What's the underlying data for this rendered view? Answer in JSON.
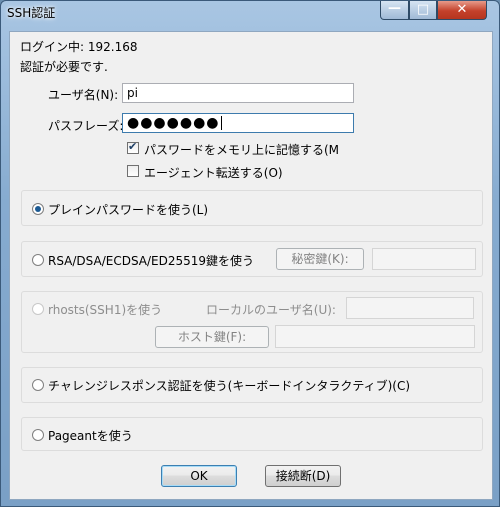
{
  "window": {
    "title": "SSH認証",
    "controls": {
      "minimize": "—",
      "maximize": "□",
      "close": "✕"
    }
  },
  "header": {
    "login_line": "ログイン中: 192.168",
    "auth_needed": "認証が必要です."
  },
  "form": {
    "username_label": "ユーザ名(N):",
    "username_value": "pi",
    "passphrase_label": "パスフレーズ:",
    "passphrase_masked": "●●●●●●●",
    "remember_password_label": "パスワードをメモリ上に記憶する(M",
    "remember_password_checked": true,
    "agent_forward_label": "エージェント転送する(O)",
    "agent_forward_checked": false
  },
  "methods": {
    "plain": {
      "label": "プレインパスワードを使う(L)",
      "selected": true
    },
    "rsa": {
      "label": "RSA/DSA/ECDSA/ED25519鍵を使う",
      "selected": false,
      "private_key_button": "秘密鍵(K):",
      "private_key_value": ""
    },
    "rhosts": {
      "label": "rhosts(SSH1)を使う",
      "selected": false,
      "disabled": true,
      "local_user_label": "ローカルのユーザ名(U):",
      "local_user_value": "",
      "host_key_button": "ホスト鍵(F):",
      "host_key_value": ""
    },
    "challenge": {
      "label": "チャレンジレスポンス認証を使う(キーボードインタラクティブ)(C)",
      "selected": false
    },
    "pageant": {
      "label": "Pageantを使う",
      "selected": false
    }
  },
  "buttons": {
    "ok": "OK",
    "disconnect": "接続断(D)"
  },
  "colors": {
    "accent": "#3c7fb1",
    "close_button": "#c4412b",
    "title_gradient_top": "#a9c6e3"
  }
}
